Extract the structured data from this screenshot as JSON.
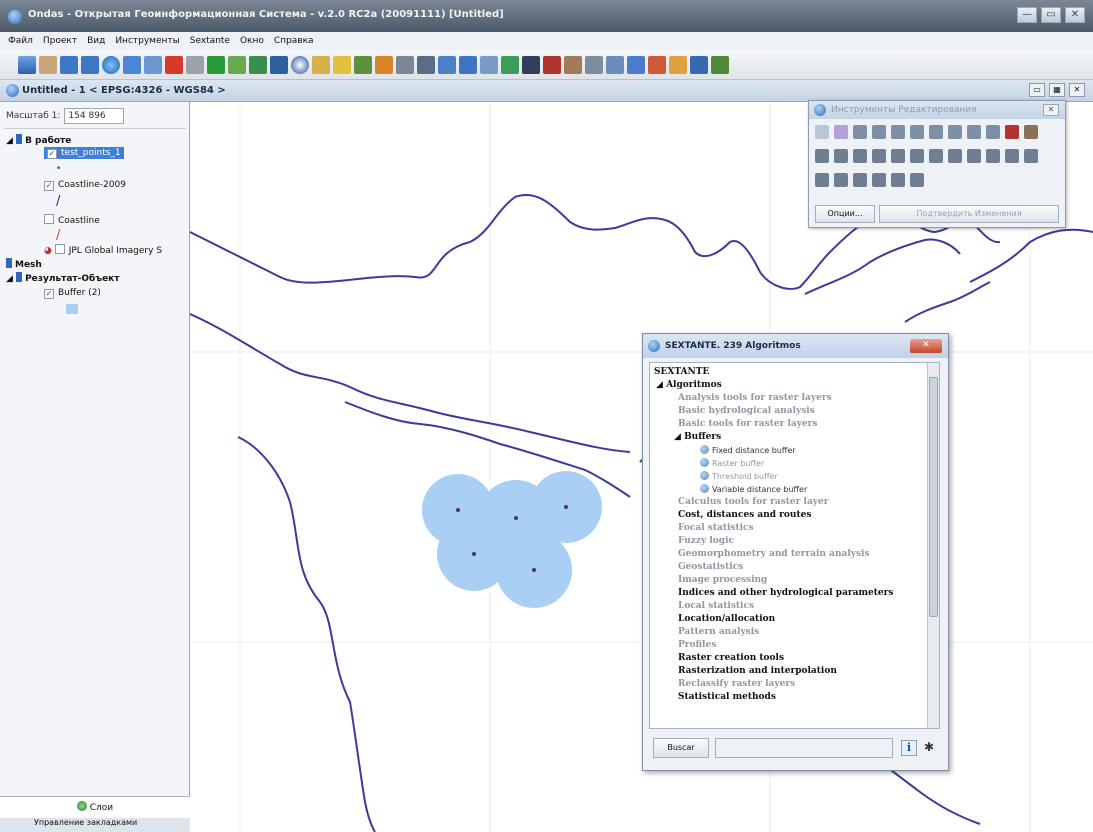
{
  "window": {
    "title": "Ondas - Открытая Геоинформационная Система - v.2.0 RC2a (20091111) [Untitled]",
    "controls": [
      "—",
      "▭",
      "✕"
    ]
  },
  "menu": [
    "Файл",
    "Проект",
    "Вид",
    "Инструменты",
    "Sextante",
    "Окно",
    "Справка"
  ],
  "view": {
    "title": "Untitled - 1 < EPSG:4326 - WGS84 >",
    "controls": [
      "▭",
      "▦",
      "✕"
    ]
  },
  "toc": {
    "scale_label": "Масштаб 1:",
    "scale_value": "154 896",
    "group1": "В работе",
    "layer1": "test_points_1",
    "layer2": "Coastline-2009",
    "layer3": "Coastline",
    "layer4": "JPL Global Imagery S",
    "group2": "Mesh",
    "group3": "Результат-Объект",
    "layer5": "Buffer (2)",
    "tab_layers": "Слои",
    "tab_bookmarks": "Управление закладками"
  },
  "edit_tools": {
    "title": "Инструменты Редактирования",
    "close": "✕",
    "options_button": "Опции...",
    "commit_button": "Подтвердить Изменения"
  },
  "sextante": {
    "title": "SEXTANTE. 239 Algoritmos",
    "close": "✕",
    "root": "SEXTANTE",
    "algorithms": "Algoritmos",
    "categories": [
      "Analysis tools for raster layers",
      "Basic hydrological analysis",
      "Basic tools for raster layers",
      "Buffers",
      "Calculus tools for raster layer",
      "Cost, distances and routes",
      "Focal statistics",
      "Fuzzy logic",
      "Geomorphometry and terrain analysis",
      "Geostatistics",
      "Image processing",
      "Indices and other hydrological parameters",
      "Local statistics",
      "Location/allocation",
      "Pattern analysis",
      "Profiles",
      "Raster creation tools",
      "Rasterization and interpolation",
      "Reclassify raster layers",
      "Statistical methods"
    ],
    "buffers": [
      "Fixed distance buffer",
      "Raster buffer",
      "Threshold buffer",
      "Variable distance buffer"
    ],
    "search_button": "Buscar",
    "search_value": "",
    "info_icon": "i"
  },
  "map": {
    "buffer_fill": "#a9cff5",
    "coastline_color": "#3b3b9c",
    "point_color": "#4b2e86"
  }
}
